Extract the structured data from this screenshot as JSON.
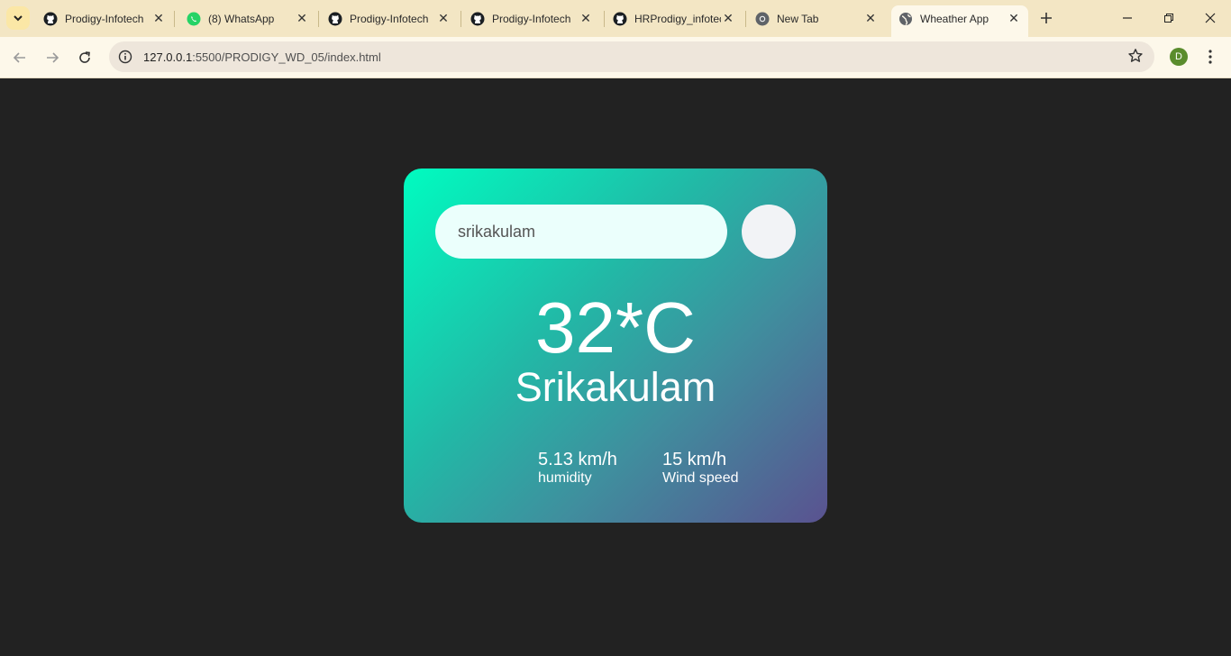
{
  "browser": {
    "tabs": [
      {
        "title": "Prodigy-Infotech",
        "icon": "github-icon"
      },
      {
        "title": "(8) WhatsApp",
        "icon": "whatsapp-icon"
      },
      {
        "title": "Prodigy-Infotech",
        "icon": "github-icon"
      },
      {
        "title": "Prodigy-Infotech",
        "icon": "github-icon"
      },
      {
        "title": "HRProdigy_infotech",
        "icon": "github-icon"
      },
      {
        "title": "New Tab",
        "icon": "chrome-icon"
      },
      {
        "title": "Wheather App",
        "icon": "globe-icon",
        "active": true
      }
    ],
    "url_host": "127.0.0.1",
    "url_path": ":5500/PRODIGY_WD_05/index.html",
    "profile_initial": "D",
    "accent": "#f3e6c4"
  },
  "weather": {
    "search_value": "srikakulam",
    "temperature": "32*C",
    "city": "Srikakulam",
    "humidity_value": "5.13 km/h",
    "humidity_label": "humidity",
    "wind_value": "15 km/h",
    "wind_label": "Wind speed"
  }
}
